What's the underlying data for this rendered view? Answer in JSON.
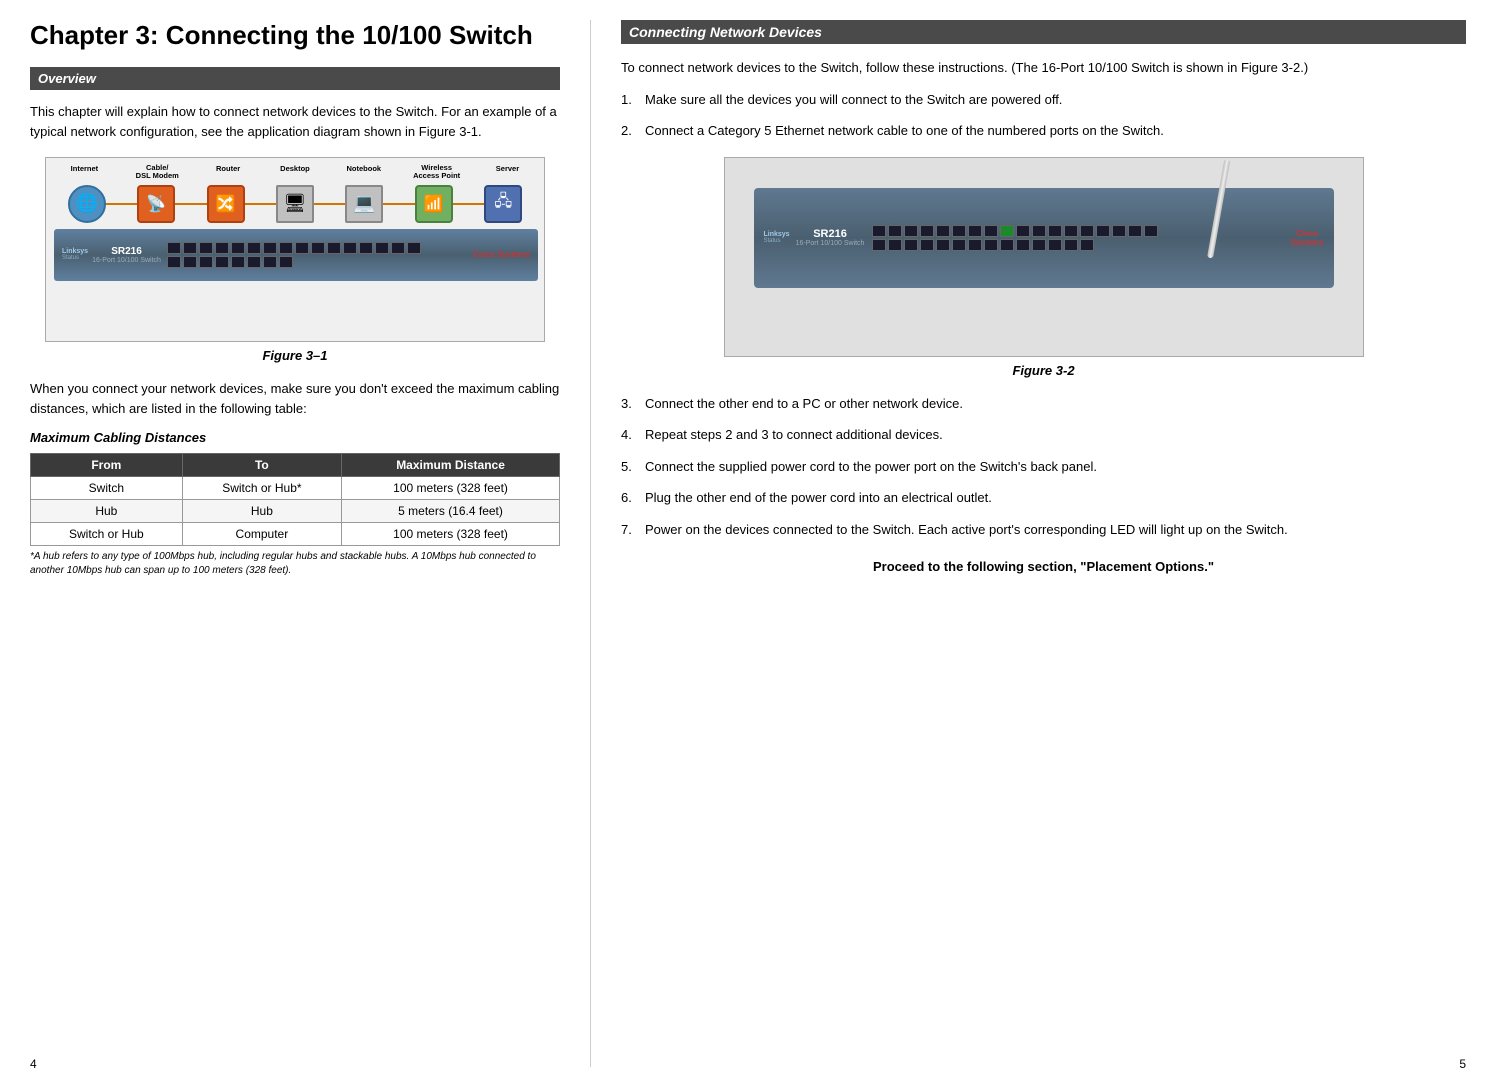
{
  "left": {
    "chapter_title": "Chapter 3: Connecting the 10/100 Switch",
    "overview_header": "Overview",
    "overview_text": "This chapter will explain how to connect network devices to the Switch. For an example of a typical network configuration, see the application diagram shown in Figure 3-1.",
    "figure1_caption": "Figure 3–1",
    "after_figure_text": "When you connect your network devices, make sure you don't exceed the maximum cabling distances, which are listed in the following table:",
    "table_title": "Maximum Cabling Distances",
    "table_headers": [
      "From",
      "To",
      "Maximum Distance"
    ],
    "table_rows": [
      [
        "Switch",
        "Switch or Hub*",
        "100 meters (328 feet)"
      ],
      [
        "Hub",
        "Hub",
        "5 meters (16.4 feet)"
      ],
      [
        "Switch or Hub",
        "Computer",
        "100 meters (328 feet)"
      ]
    ],
    "table_footnote": "*A hub refers to any type of 100Mbps hub, including regular hubs and stackable hubs. A 10Mbps hub connected to another 10Mbps hub can span up to 100 meters (328 feet).",
    "network_devices": [
      {
        "label": "Internet",
        "icon": "🌐"
      },
      {
        "label": "Cable/\nDSL Modem",
        "icon": "📡"
      },
      {
        "label": "Router",
        "icon": "🔀"
      },
      {
        "label": "Desktop",
        "icon": "🖥️"
      },
      {
        "label": "Notebook",
        "icon": "💻"
      },
      {
        "label": "Wireless\nAccess Point",
        "icon": "📶"
      },
      {
        "label": "Server",
        "icon": "🖧"
      }
    ],
    "switch_model": "SR216",
    "switch_subtitle": "16-Port 10/100 Switch",
    "page_number": "4"
  },
  "right": {
    "connecting_header": "Connecting Network Devices",
    "intro_text": "To connect network devices to the Switch, follow these instructions. (The 16-Port 10/100 Switch is shown in Figure 3-2.)",
    "steps": [
      "Make sure all the devices you will connect to the Switch are powered off.",
      "Connect a Category 5 Ethernet network cable to one of the numbered ports on the Switch.",
      "Connect the other end to a PC or other network device.",
      "Repeat steps 2 and 3 to connect additional devices.",
      "Connect the supplied power cord to the power port on the Switch's back panel.",
      "Plug the other end of the power cord into an electrical outlet.",
      "Power on the devices connected to the Switch. Each active port's corresponding LED will light up on the Switch."
    ],
    "figure2_caption": "Figure 3-2",
    "bottom_note": "Proceed to the following section, \"Placement Options.\"",
    "switch_model": "SR216",
    "switch_subtitle": "16-Port 10/100 Switch",
    "page_number": "5"
  }
}
